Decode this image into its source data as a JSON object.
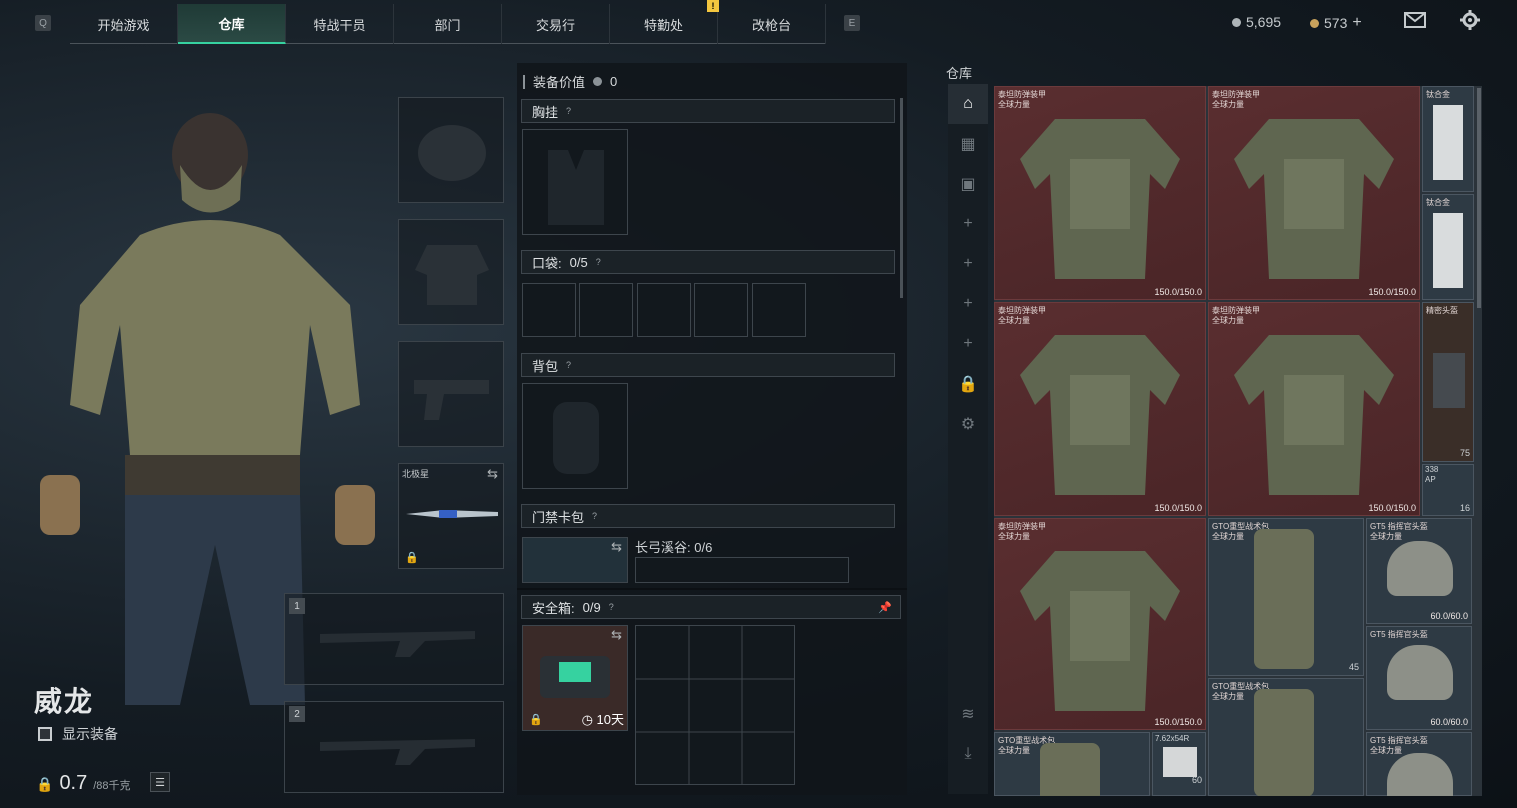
{
  "topnav": {
    "left_key": "Q",
    "right_key": "E",
    "tabs": [
      {
        "label": "开始游戏",
        "active": false
      },
      {
        "label": "仓库",
        "active": true
      },
      {
        "label": "特战干员",
        "active": false
      },
      {
        "label": "部门",
        "active": false
      },
      {
        "label": "交易行",
        "active": false
      },
      {
        "label": "特勤处",
        "active": false
      },
      {
        "label": "改枪台",
        "active": false
      }
    ],
    "notice": "!",
    "currency1": "5,695",
    "currency2": "573",
    "currency_add": "+",
    "accent": "#36d2a0"
  },
  "character": {
    "name": "威龙",
    "show_equipment_label": "显示装备",
    "weight_value": "0.7",
    "weight_max": "/88千克"
  },
  "equip": {
    "melee_label": "北极星",
    "slot1": "1",
    "slot2": "2"
  },
  "middle": {
    "value_label": "装备价值",
    "value": "0",
    "chest_rig": "胸挂",
    "pockets": "口袋:",
    "pockets_count": "0/5",
    "backpack": "背包",
    "keycard": "门禁卡包",
    "keycard_name": "长弓溪谷: 0/6",
    "safebox": "安全箱:",
    "safebox_count": "0/9",
    "safebox_timer": "10天",
    "help": "?"
  },
  "warehouse": {
    "title": "仓库",
    "items": [
      {
        "name": "泰坦防弹装甲",
        "sub": "全球力量",
        "dur": "150.0/150.0"
      },
      {
        "name": "泰坦防弹装甲",
        "sub": "全球力量",
        "dur": "150.0/150.0"
      },
      {
        "name": "泰坦防弹装甲",
        "sub": "全球力量",
        "dur": "150.0/150.0"
      },
      {
        "name": "泰坦防弹装甲",
        "sub": "全球力量",
        "dur": "150.0/150.0"
      },
      {
        "name": "泰坦防弹装甲",
        "sub": "全球力量",
        "dur": "150.0/150.0"
      }
    ],
    "ti1": "钛合金",
    "ti2": "钛合金",
    "precise": "精密头盔",
    "precise_dur": "75",
    "ammo_count": "338",
    "ammo_label": "AP",
    "ammo_16": "16",
    "gto1": "GTO重型战术包",
    "gto_sub": "全球力量",
    "gto_count": "45",
    "gto2": "GTO重型战术包",
    "gto3": "GTO重型战术包",
    "gt5a": "GT5 指挥官头盔",
    "gt5b": "GT5 指挥官头盔",
    "gt5c": "GT5 指挥官头盔",
    "gt5_sub": "全球力量",
    "gt5_dur": "60.0/60.0",
    "ammo2": "7.62x54R",
    "ammo2_count": "60"
  }
}
